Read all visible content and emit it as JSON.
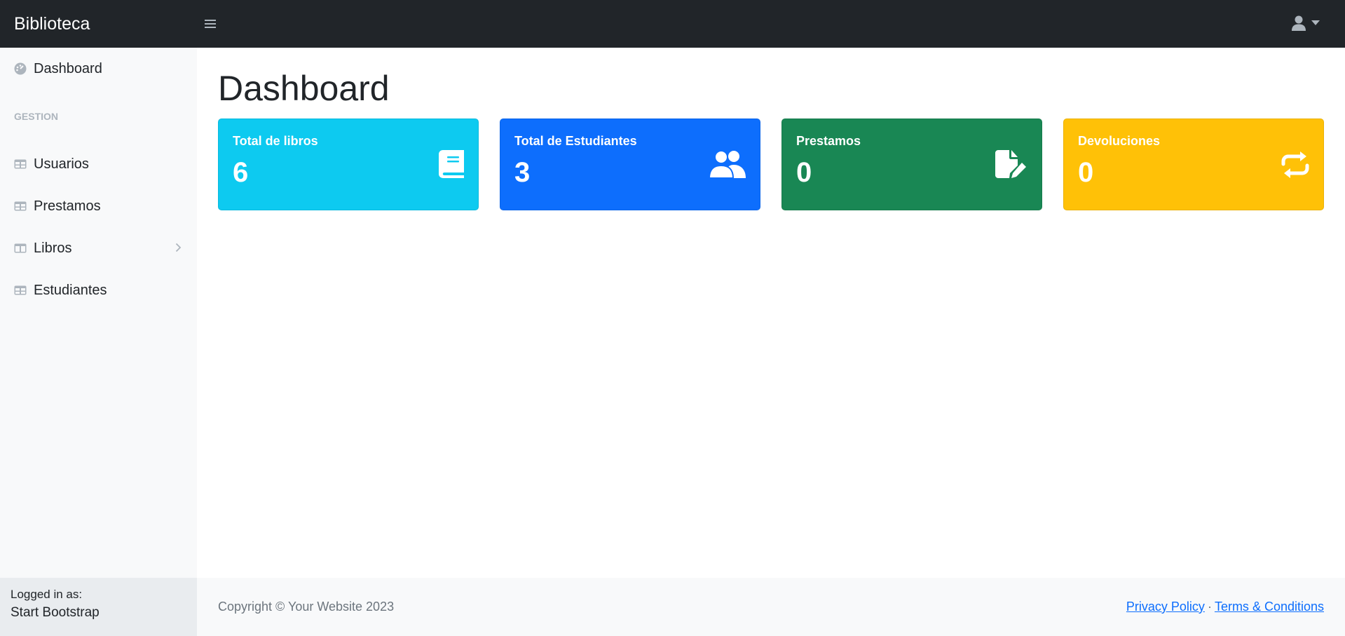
{
  "brand": "Biblioteca",
  "sidebar": {
    "items": [
      {
        "label": "Dashboard",
        "icon": "gauge-icon"
      },
      {
        "label": "Usuarios",
        "icon": "table-icon"
      },
      {
        "label": "Prestamos",
        "icon": "table-icon"
      },
      {
        "label": "Libros",
        "icon": "columns-icon"
      },
      {
        "label": "Estudiantes",
        "icon": "table-icon"
      }
    ],
    "heading": "GESTION",
    "footer_label": "Logged in as:",
    "footer_name": "Start Bootstrap"
  },
  "main": {
    "title": "Dashboard",
    "cards": [
      {
        "label": "Total de libros",
        "value": "6",
        "color": "#0dcaf0",
        "icon": "book-icon"
      },
      {
        "label": "Total de Estudiantes",
        "value": "3",
        "color": "#0d6efd",
        "icon": "users-icon"
      },
      {
        "label": "Prestamos",
        "value": "0",
        "color": "#198754",
        "icon": "file-pen-icon"
      },
      {
        "label": "Devoluciones",
        "value": "0",
        "color": "#ffc107",
        "icon": "repeat-icon"
      }
    ]
  },
  "footer": {
    "copyright": "Copyright © Your Website 2023",
    "privacy": "Privacy Policy",
    "separator": "·",
    "terms": "Terms & Conditions"
  }
}
